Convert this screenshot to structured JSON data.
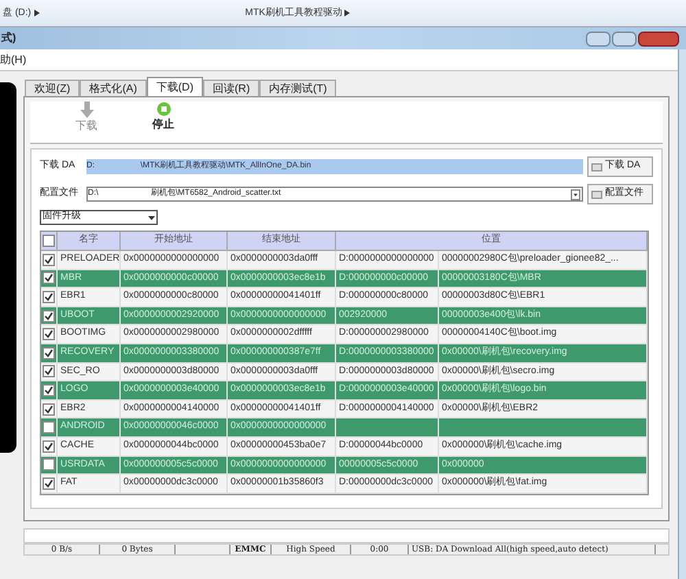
{
  "explorer": {
    "crumbs": [
      "盘 (D:)",
      "MTK刷机工具教程驱动"
    ]
  },
  "window": {
    "title": "式)"
  },
  "menu": [
    "助(H)"
  ],
  "tabs": [
    {
      "label": "欢迎(Z)",
      "selected": false
    },
    {
      "label": "格式化(A)",
      "selected": false
    },
    {
      "label": "下载(D)",
      "selected": true
    },
    {
      "label": "回读(R)",
      "selected": false
    },
    {
      "label": "内存测试(T)",
      "selected": false
    }
  ],
  "toolbar": [
    {
      "label": "下载",
      "kind": "download",
      "disabled": true
    },
    {
      "label": "停止",
      "kind": "stop",
      "disabled": false
    }
  ],
  "da": {
    "label": "下载 DA",
    "value": "D:                    \\MTK刷机工具教程驱动\\MTK_AllInOne_DA.bin",
    "button": "下载 DA"
  },
  "scatter": {
    "label": "配置文件",
    "value": "D:\\                       刷机包\\MT6582_Android_scatter.txt",
    "button": "配置文件"
  },
  "mode": {
    "value": "固件升级"
  },
  "table": {
    "all_checked": false,
    "columns": [
      "名字",
      "开始地址",
      "结束地址",
      "位置"
    ],
    "rows": [
      {
        "checked": true,
        "highlighted": false,
        "name": "PRELOADER",
        "start": "0x0000000000000000",
        "end": "0x0000000003da0fff",
        "location": "D:0000000000000000",
        "file": "00000002980C包\\preloader_gionee82_..."
      },
      {
        "checked": true,
        "highlighted": true,
        "name": "MBR",
        "start": "0x0000000000c00000",
        "end": "0x0000000003ec8e1b",
        "location": "D:000000000c00000",
        "file": "00000003180C包\\MBR"
      },
      {
        "checked": true,
        "highlighted": false,
        "name": "EBR1",
        "start": "0x0000000000c80000",
        "end": "0x00000000041401ff",
        "location": "D:000000000c80000",
        "file": "00000003d80C包\\EBR1"
      },
      {
        "checked": true,
        "highlighted": true,
        "name": "UBOOT",
        "start": "0x0000000002920000",
        "end": "0x0000000000000000",
        "location": "002920000",
        "file": "00000003e400包\\lk.bin"
      },
      {
        "checked": true,
        "highlighted": false,
        "name": "BOOTIMG",
        "start": "0x0000000002980000",
        "end": "0x0000000002dfffff",
        "location": "D:000000002980000",
        "file": "00000004140C包\\boot.img"
      },
      {
        "checked": true,
        "highlighted": true,
        "name": "RECOVERY",
        "start": "0x0000000003380000",
        "end": "0x000000000387e7ff",
        "location": "D:0000000003380000",
        "file": "0x00000\\刷机包\\recovery.img"
      },
      {
        "checked": true,
        "highlighted": false,
        "name": "SEC_RO",
        "start": "0x0000000003d80000",
        "end": "0x0000000003da0fff",
        "location": "D:0000000003d80000",
        "file": "0x00000\\刷机包\\secro.img"
      },
      {
        "checked": true,
        "highlighted": true,
        "name": "LOGO",
        "start": "0x0000000003e40000",
        "end": "0x0000000003ec8e1b",
        "location": "D:0000000003e40000",
        "file": "0x00000\\刷机包\\logo.bin"
      },
      {
        "checked": true,
        "highlighted": false,
        "name": "EBR2",
        "start": "0x0000000004140000",
        "end": "0x00000000041401ff",
        "location": "D:0000000004140000",
        "file": "0x00000\\刷机包\\EBR2"
      },
      {
        "checked": false,
        "highlighted": true,
        "name": "ANDROID",
        "start": "0x00000000046c0000",
        "end": "0x0000000000000000",
        "location": "",
        "file": ""
      },
      {
        "checked": true,
        "highlighted": false,
        "name": "CACHE",
        "start": "0x0000000044bc0000",
        "end": "0x00000000453ba0e7",
        "location": "D:00000044bc0000",
        "file": "0x000000\\刷机包\\cache.img"
      },
      {
        "checked": false,
        "highlighted": true,
        "name": "USRDATA",
        "start": "0x000000005c5c0000",
        "end": "0x0000000000000000",
        "location": "00000005c5c0000",
        "file": "0x000000"
      },
      {
        "checked": true,
        "highlighted": false,
        "name": "FAT",
        "start": "0x00000000dc3c0000",
        "end": "0x00000001b35860f3",
        "location": "D:00000000dc3c0000",
        "file": "0x000000\\刷机包\\fat.img"
      }
    ]
  },
  "progress": {
    "level": 0
  },
  "status": [
    "0 B/s",
    "0 Bytes",
    "EMMC",
    "High Speed",
    "0:00",
    "USB: DA Download All(high speed,auto detect)"
  ]
}
